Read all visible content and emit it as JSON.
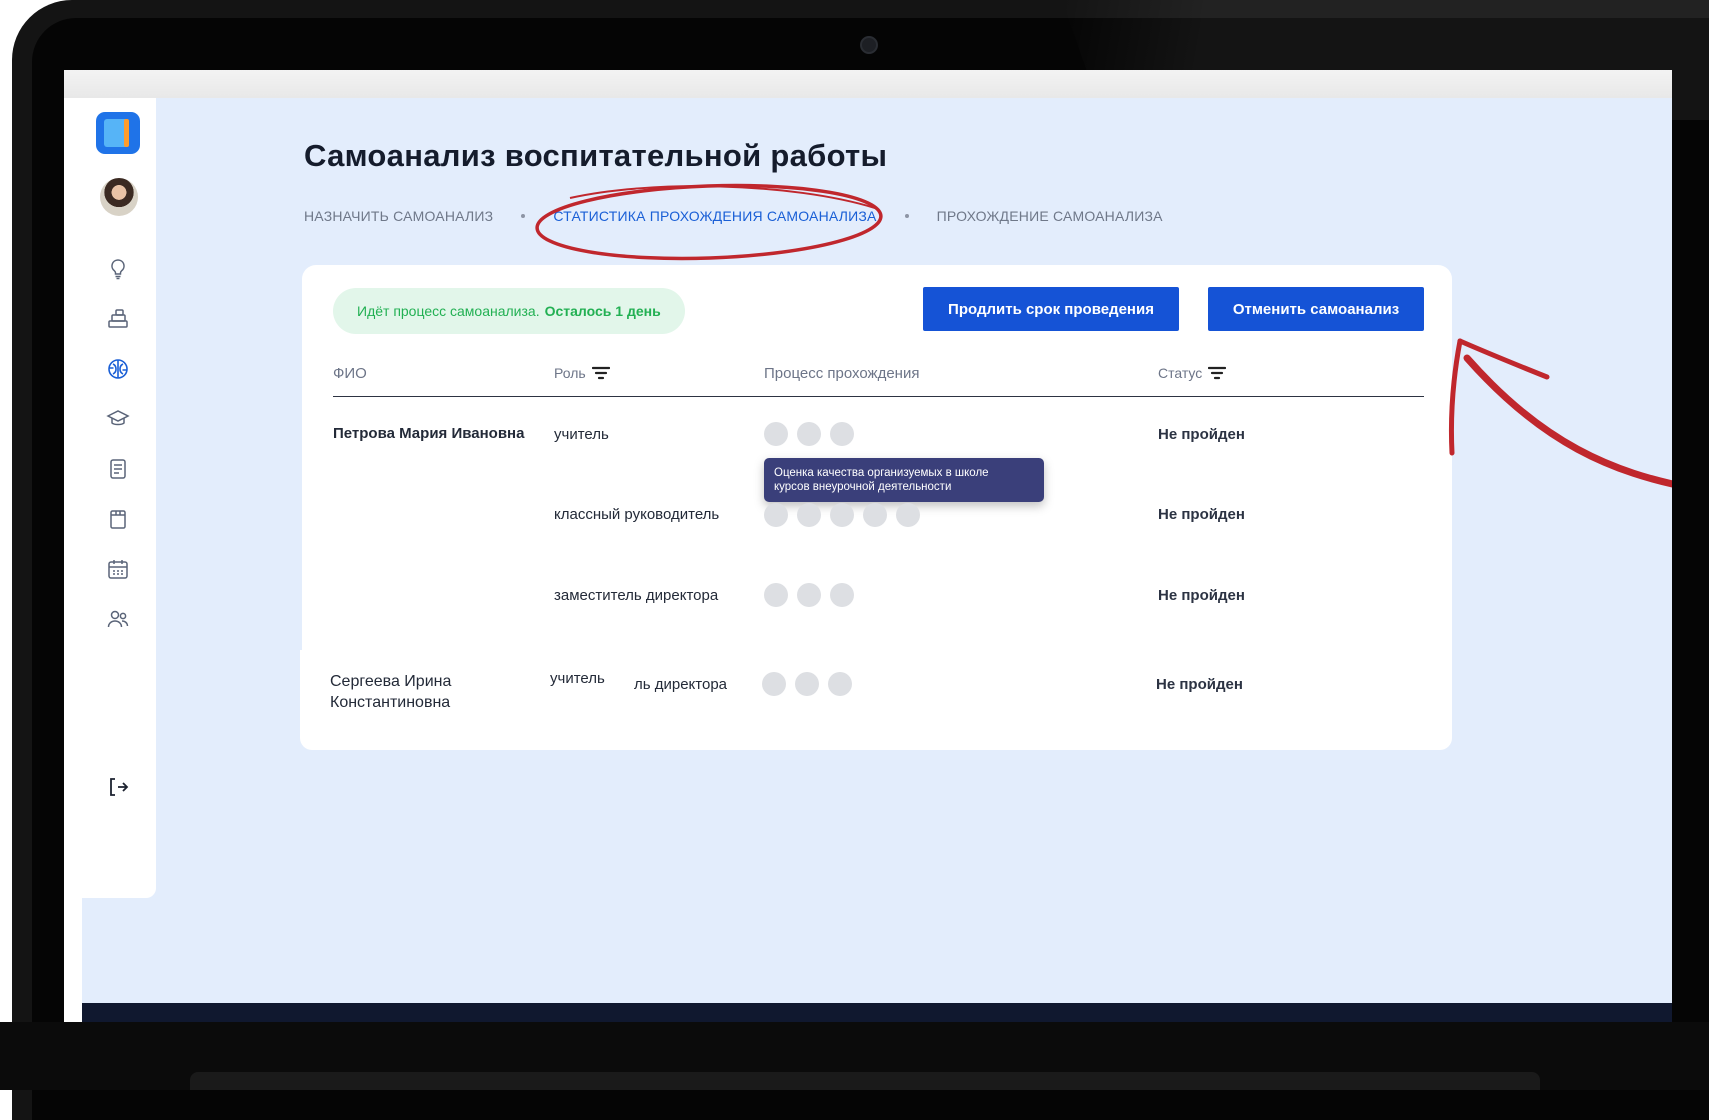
{
  "app": {
    "title": "Самоанализ воспитательной работы",
    "breadcrumbs": [
      {
        "label": "НАЗНАЧИТЬ САМОАНАЛИЗ",
        "active": false
      },
      {
        "label": "СТАТИСТИКА ПРОХОЖДЕНИЯ САМОАНАЛИЗА",
        "active": true
      },
      {
        "label": "ПРОХОЖДЕНИЕ САМОАНАЛИЗА",
        "active": false
      }
    ]
  },
  "sidebar": {
    "icons": [
      "lightbulb-icon",
      "blocks-icon",
      "brain-icon",
      "graduation-cap-icon",
      "document-icon",
      "clipboard-icon",
      "calendar-icon",
      "users-icon"
    ],
    "active_icon": "brain-icon",
    "logout_icon": "logout-icon"
  },
  "status": {
    "text": "Идёт процесс самоанализа.",
    "remaining": "Осталось 1 день"
  },
  "actions": {
    "extend_label": "Продлить срок проведения",
    "cancel_label": "Отменить самоанализ"
  },
  "table": {
    "headers": {
      "name": "ФИО",
      "role": "Роль",
      "progress": "Процесс прохождения",
      "status": "Статус"
    },
    "rows": [
      {
        "name": "Петрова Мария Ивановна",
        "role": "учитель",
        "steps": 3,
        "status": "Не пройден"
      },
      {
        "name": "",
        "role": "классный руководитель",
        "steps": 5,
        "status": "Не пройден"
      },
      {
        "name": "",
        "role": "заместитель директора",
        "steps": 3,
        "status": "Не пройден"
      },
      {
        "name_line1": "Сергеева Ирина",
        "name_line2": "Константиновна",
        "role": "учитель",
        "role_overlap": "ль директора",
        "steps": 3,
        "status": "Не пройден"
      }
    ],
    "tooltip": {
      "line1": "Оценка качества организуемых в школе",
      "line2": "курсов внеурочной деятельности"
    }
  },
  "colors": {
    "primary": "#1553d6",
    "accent_link": "#1a5fd6",
    "success": "#22b053",
    "annotation": "#c0272d",
    "app_bg": "#e3edfc"
  }
}
